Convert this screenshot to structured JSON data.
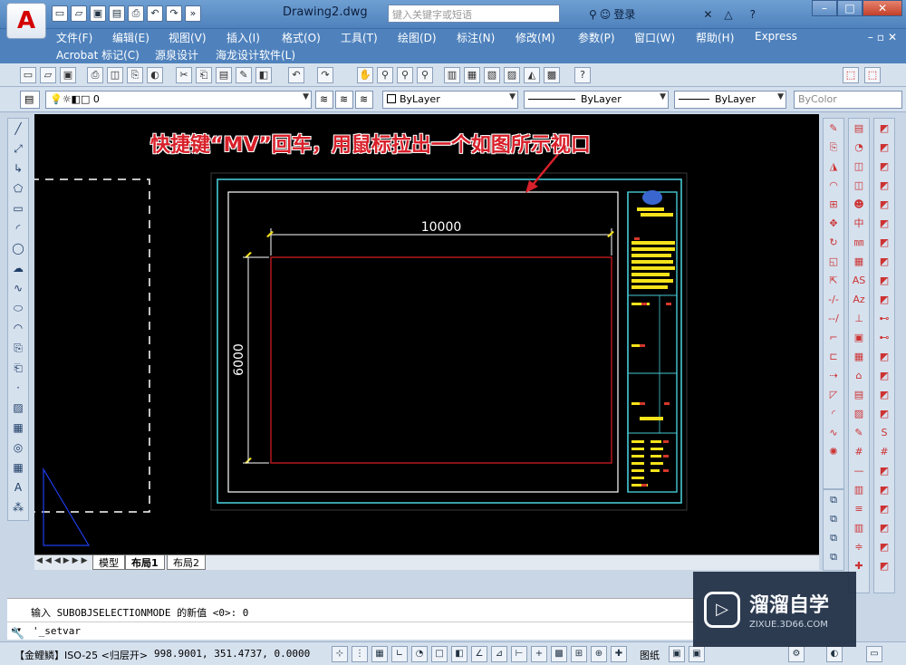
{
  "titlebar": {
    "doc_title": "Drawing2.dwg",
    "search_placeholder": "键入关键字或短语",
    "login_label": "登录"
  },
  "menu": {
    "row1": [
      "文件(F)",
      "编辑(E)",
      "视图(V)",
      "插入(I)",
      "格式(O)",
      "工具(T)",
      "绘图(D)",
      "标注(N)",
      "修改(M)",
      "参数(P)",
      "窗口(W)",
      "帮助(H)",
      "Express"
    ],
    "row2": [
      "Acrobat 标记(C)",
      "源泉设计",
      "海龙设计软件(L)"
    ]
  },
  "layer_toolbar": {
    "layer_value": "0",
    "color_value": "ByLayer",
    "linetype_value": "ByLayer",
    "lineweight_value": "ByLayer",
    "plotstyle_value": "ByColor"
  },
  "annotation": "快捷键“MV”回车，用鼠标拉出一个如图所示视口",
  "drawing": {
    "dimension_horizontal": "10000",
    "dimension_vertical": "6000",
    "colors": {
      "sheet_border": "#46c8d2",
      "inner_frame": "#ffffff",
      "viewport_rect": "#c0191f",
      "dimension": "#ffffff",
      "title_block_text": "#f5e21a",
      "title_block_marks": "#d4372a",
      "dashed": "#ffffff",
      "triangle": "#1f3ff0"
    }
  },
  "tabs": [
    "模型",
    "布局1",
    "布局2"
  ],
  "command": {
    "history": "输入 SUBOBJSELECTIONMODE 的新值 <0>: 0",
    "current": "'_setvar"
  },
  "status": {
    "layer_label": "【金鲤鳞】ISO-25 <归层开>",
    "coordinates": "998.9001,   351.4737, 0.0000",
    "paper_label": "图纸"
  },
  "watermark": {
    "brand": "溜溜自学",
    "url": "ZIXUE.3D66.COM"
  }
}
